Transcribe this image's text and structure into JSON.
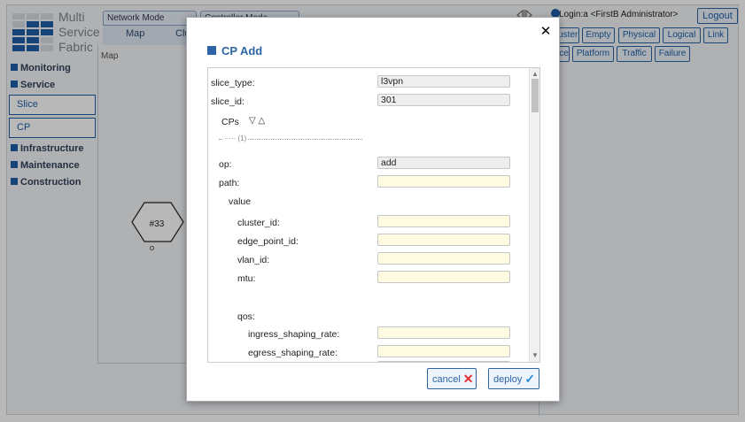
{
  "app": {
    "logo": {
      "line1": "Multi",
      "line2": "Service",
      "line3": "Fabric"
    },
    "sidebar": {
      "sections": [
        {
          "label": "Monitoring"
        },
        {
          "label": "Service"
        }
      ],
      "items": [
        {
          "label": "Slice"
        },
        {
          "label": "CP"
        }
      ],
      "sections2": [
        {
          "label": "Infrastructure"
        },
        {
          "label": "Maintenance"
        },
        {
          "label": "Construction"
        }
      ]
    },
    "mode_tabs": [
      {
        "label": "Network Mode"
      },
      {
        "label": "Controller Mode"
      }
    ],
    "subtabs": [
      {
        "label": "Map"
      },
      {
        "label": "Clus"
      }
    ],
    "map_label": "Map",
    "node": {
      "label": "#33"
    },
    "login": "Login:a <FirstB Administrator>",
    "logout_label": "Logout",
    "layer_buttons": [
      {
        "label": "Cluster"
      },
      {
        "label": "Empty"
      },
      {
        "label": "Physical"
      },
      {
        "label": "Logical"
      },
      {
        "label": "Link"
      },
      {
        "label": "Slice"
      },
      {
        "label": "Platform"
      },
      {
        "label": "Traffic"
      },
      {
        "label": "Failure"
      }
    ]
  },
  "dialog": {
    "title": "CP Add",
    "close_icon": "close-icon",
    "fields": {
      "slice_type": {
        "label": "slice_type:",
        "value": "l3vpn"
      },
      "slice_id": {
        "label": "slice_id:",
        "value": "301"
      },
      "cps_label": "CPs",
      "sort_icons": "▽ △",
      "separator": "(1)",
      "op": {
        "label": "op:",
        "value": "add"
      },
      "path": {
        "label": "path:",
        "value": ""
      },
      "value_group": "value",
      "cluster_id": {
        "label": "cluster_id:",
        "value": ""
      },
      "edge_point_id": {
        "label": "edge_point_id:",
        "value": ""
      },
      "vlan_id": {
        "label": "vlan_id:",
        "value": ""
      },
      "mtu": {
        "label": "mtu:",
        "value": ""
      },
      "qos_group": "qos:",
      "ingress_shaping_rate": {
        "label": "ingress_shaping_rate:",
        "value": ""
      },
      "egress_shaping_rate": {
        "label": "egress_shaping_rate:",
        "value": ""
      }
    },
    "cancel_label": "cancel",
    "deploy_label": "deploy",
    "colors": {
      "accent": "#2c64a6",
      "cancel_icon": "#e03030",
      "deploy_icon": "#2a8ad8",
      "readonly_bg": "#eeeeee",
      "editable_bg": "#fffbe0"
    }
  }
}
